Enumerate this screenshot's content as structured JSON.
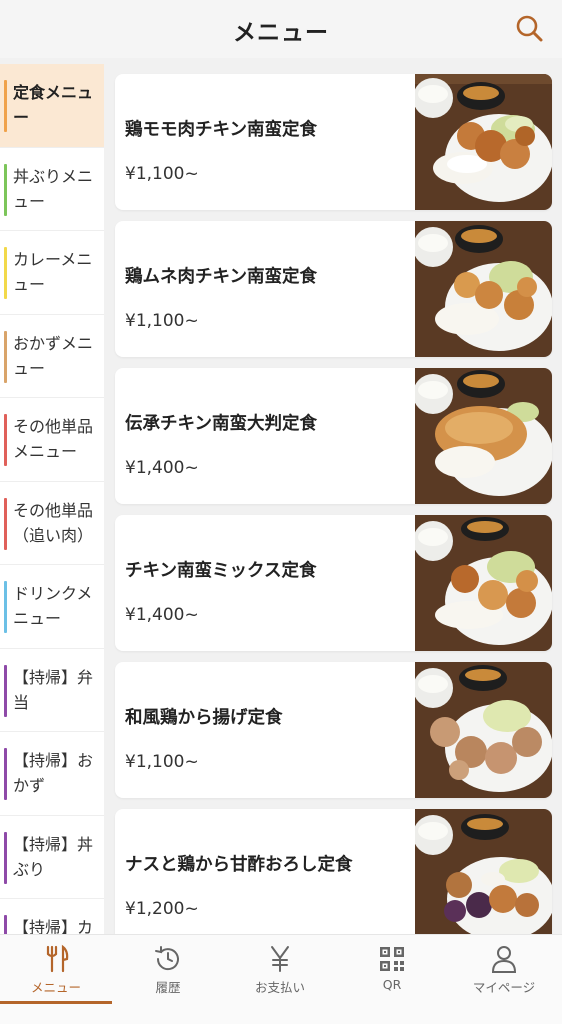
{
  "header": {
    "title": "メニュー"
  },
  "colors": {
    "accent": "#b4652a",
    "active_bg": "#fbe8d3"
  },
  "sidebar": {
    "items": [
      {
        "label": "定食メニュー",
        "color": "#f0a24a",
        "active": true
      },
      {
        "label": "丼ぶりメニュー",
        "color": "#7cc55a"
      },
      {
        "label": "カレーメニュー",
        "color": "#f2d94a"
      },
      {
        "label": "おかずメニュー",
        "color": "#d9a46a"
      },
      {
        "label": "その他単品メニュー",
        "color": "#e0605a"
      },
      {
        "label": "その他単品（追い肉）",
        "color": "#e0605a"
      },
      {
        "label": "ドリンクメニュー",
        "color": "#6cc0e6"
      },
      {
        "label": "【持帰】弁当",
        "color": "#8e4aa8"
      },
      {
        "label": "【持帰】おかず",
        "color": "#8e4aa8"
      },
      {
        "label": "【持帰】丼ぶり",
        "color": "#8e4aa8"
      },
      {
        "label": "【持帰】カ",
        "color": "#8e4aa8"
      }
    ]
  },
  "menu": {
    "items": [
      {
        "name": "鶏モモ肉チキン南蛮定食",
        "price": "¥1,100~"
      },
      {
        "name": "鶏ムネ肉チキン南蛮定食",
        "price": "¥1,100~"
      },
      {
        "name": "伝承チキン南蛮大判定食",
        "price": "¥1,400~"
      },
      {
        "name": "チキン南蛮ミックス定食",
        "price": "¥1,400~"
      },
      {
        "name": "和風鶏から揚げ定食",
        "price": "¥1,100~"
      },
      {
        "name": "ナスと鶏から甘酢おろし定食",
        "price": "¥1,200~"
      }
    ]
  },
  "tabbar": {
    "tabs": [
      {
        "label": "メニュー",
        "icon": "fork-knife-icon",
        "active": true
      },
      {
        "label": "履歴",
        "icon": "history-icon"
      },
      {
        "label": "お支払い",
        "icon": "yen-icon"
      },
      {
        "label": "QR",
        "icon": "qr-code-icon"
      },
      {
        "label": "マイページ",
        "icon": "user-icon"
      }
    ]
  }
}
